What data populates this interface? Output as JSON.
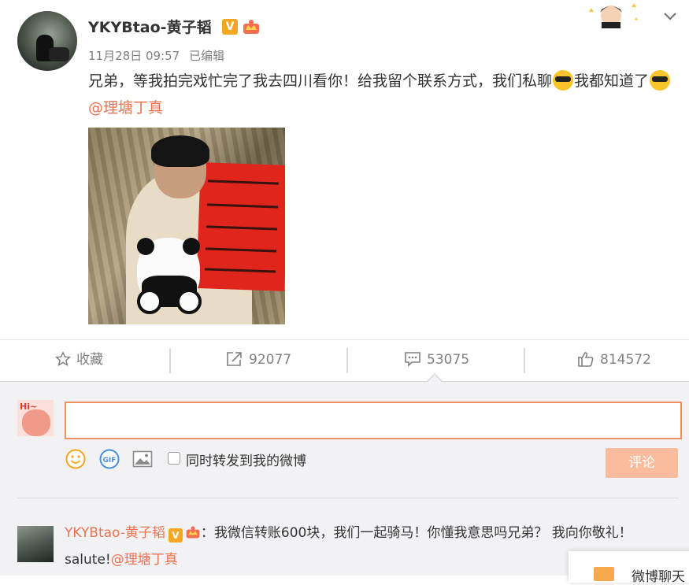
{
  "post": {
    "author": "YKYBtao-黄子韬",
    "verified_badge": "V",
    "date": "11月28日 09:57",
    "edited": "已编辑",
    "text_main": "兄弟，等我拍完戏忙完了我去四川看你！给我留个联系方式，我们私聊",
    "text_tail_1": "我都知道了",
    "mention": "@理塘丁真"
  },
  "actions": {
    "favorite_label": "收藏",
    "repost_count": "92077",
    "comment_count": "53075",
    "like_count": "814572"
  },
  "composer": {
    "input_value": "",
    "forward_label": "同时转发到我的微博",
    "submit_label": "评论"
  },
  "comment": {
    "author": "YKYBtao-黄子韬",
    "verified_badge": "V",
    "text": "：我微信转账600块，我们一起骑马！你懂我意思吗兄弟？ 我向你敬礼！salute!",
    "mention": "@理塘丁真"
  },
  "chat": {
    "label": "微博聊天"
  },
  "colors": {
    "accent": "#eb7350",
    "submit_disabled": "#fbbc9e",
    "badge": "#f5a623"
  }
}
